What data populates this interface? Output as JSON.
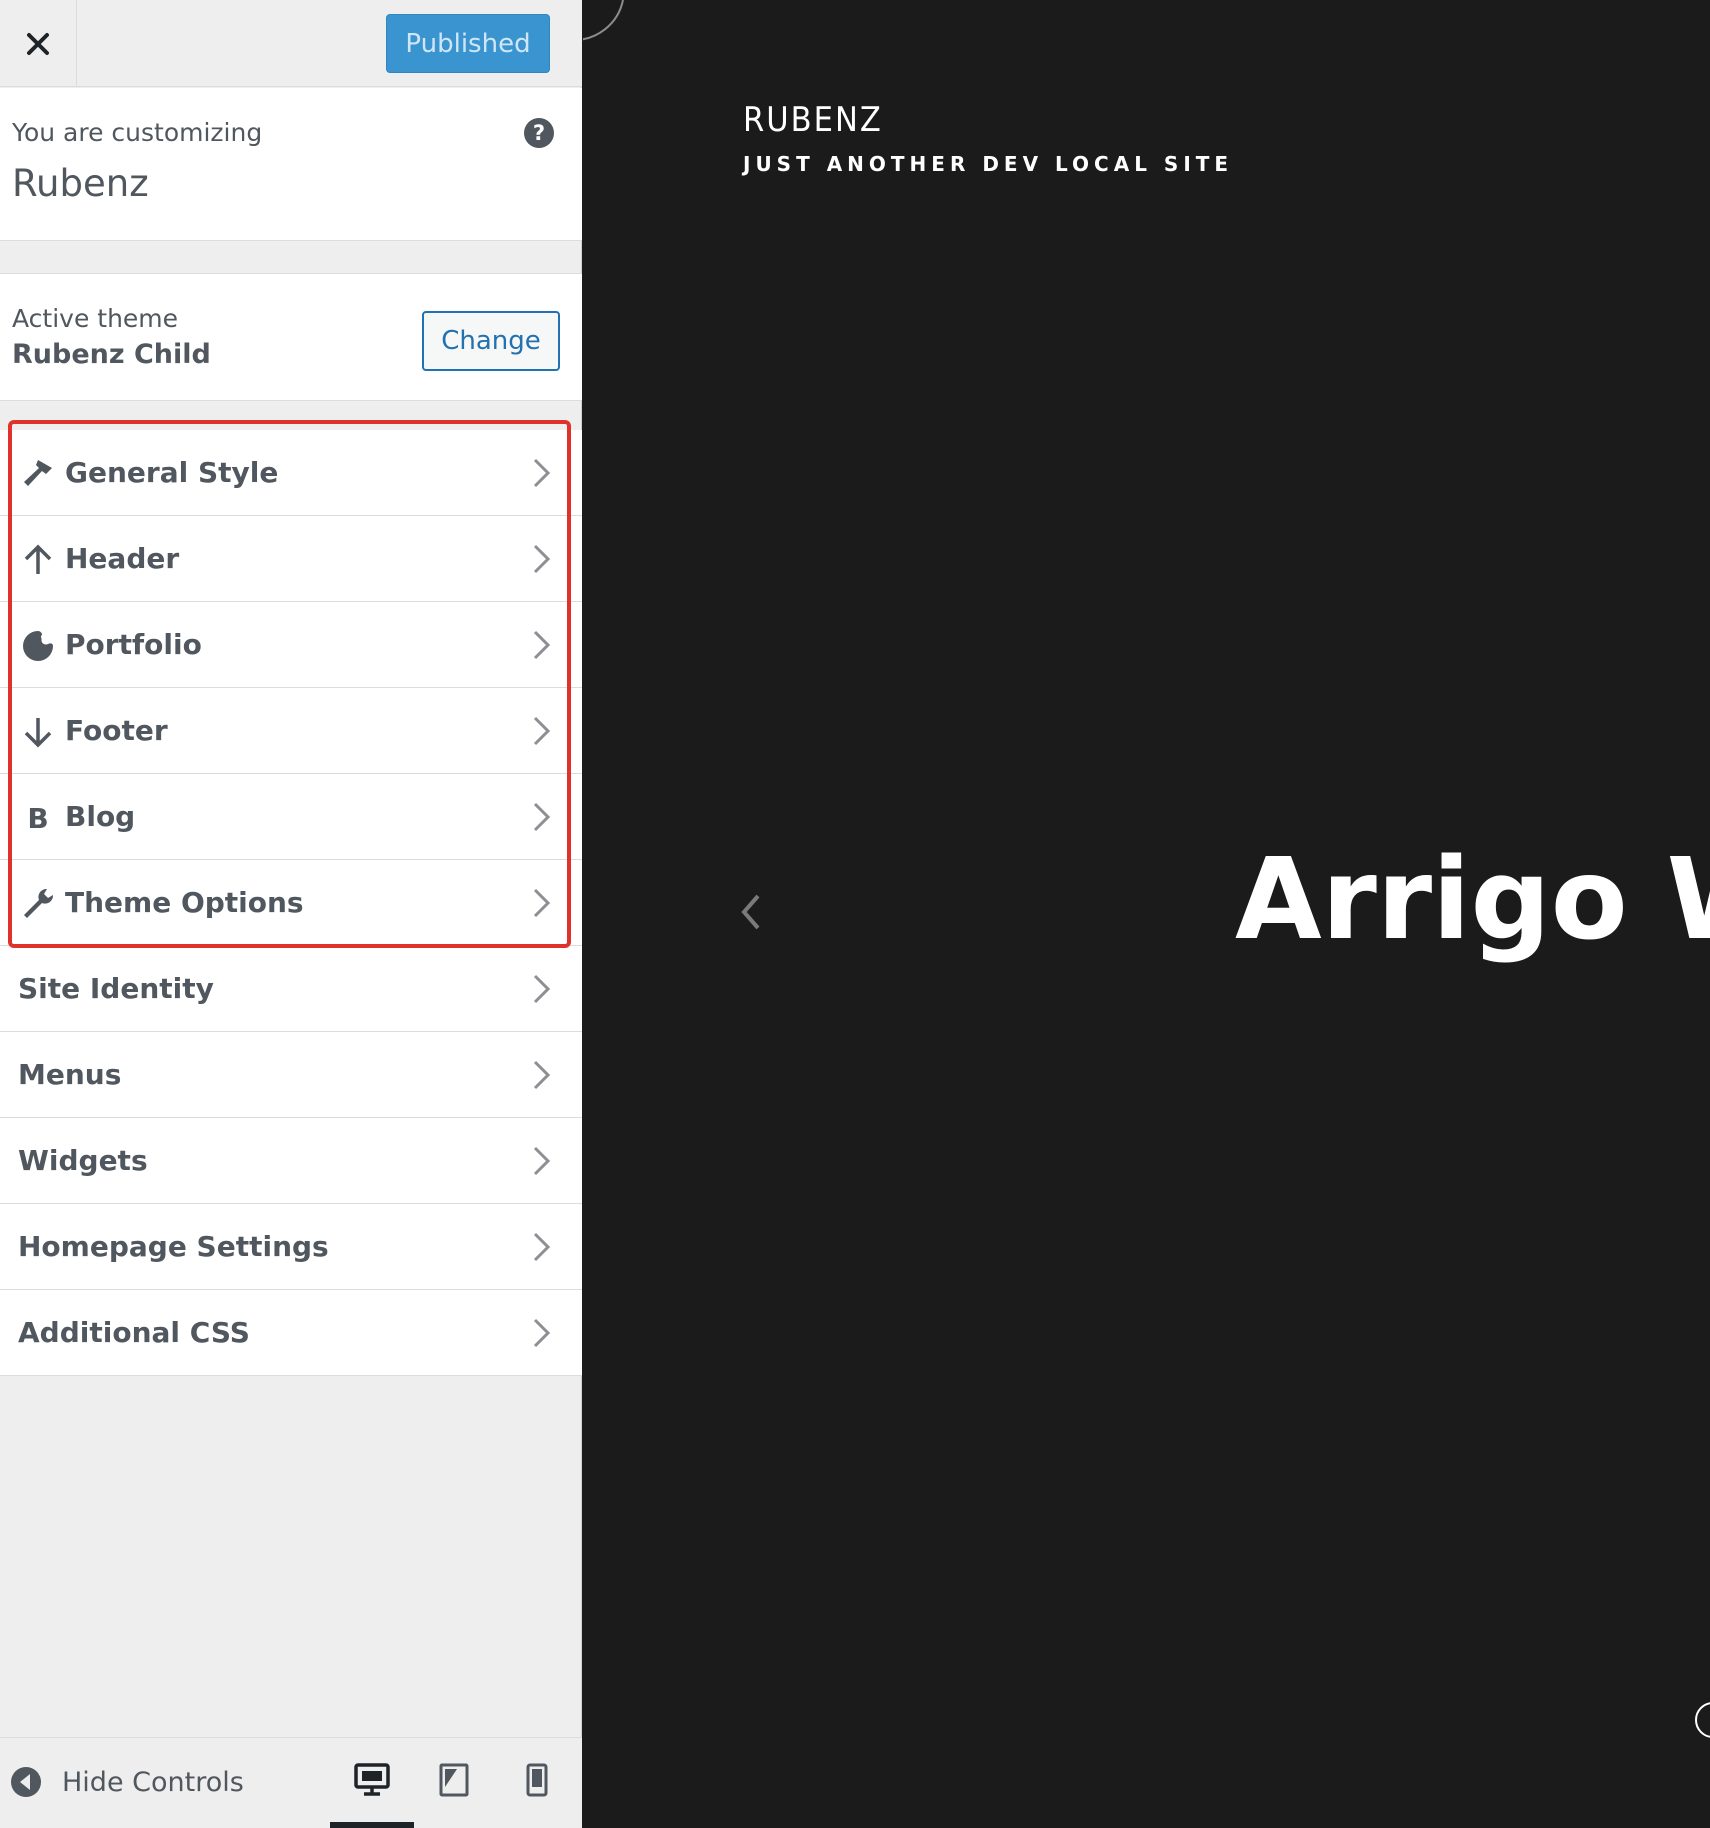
{
  "topbar": {
    "close_label": "×",
    "publish_label": "Published"
  },
  "info": {
    "pre_title": "You are customizing",
    "title": "Rubenz",
    "help": "?"
  },
  "theme": {
    "label": "Active theme",
    "name": "Rubenz Child",
    "change_label": "Change"
  },
  "sections": {
    "general_style": "General Style",
    "header": "Header",
    "portfolio": "Portfolio",
    "footer": "Footer",
    "blog": "Blog",
    "blog_letter": "B",
    "theme_options": "Theme Options",
    "site_identity": "Site Identity",
    "menus": "Menus",
    "widgets": "Widgets",
    "homepage_settings": "Homepage Settings",
    "additional_css": "Additional CSS"
  },
  "footer_controls": {
    "hide_label": "Hide Controls",
    "active_device": "desktop"
  },
  "preview": {
    "site_title": "RUBENZ",
    "tagline": "JUST ANOTHER DEV LOCAL SITE",
    "hero_text": "Arrigo W"
  },
  "colors": {
    "highlight": "#e0322d",
    "publish_bg": "#3a94cf",
    "link": "#2271b1",
    "preview_bg": "#1b1b1b"
  }
}
